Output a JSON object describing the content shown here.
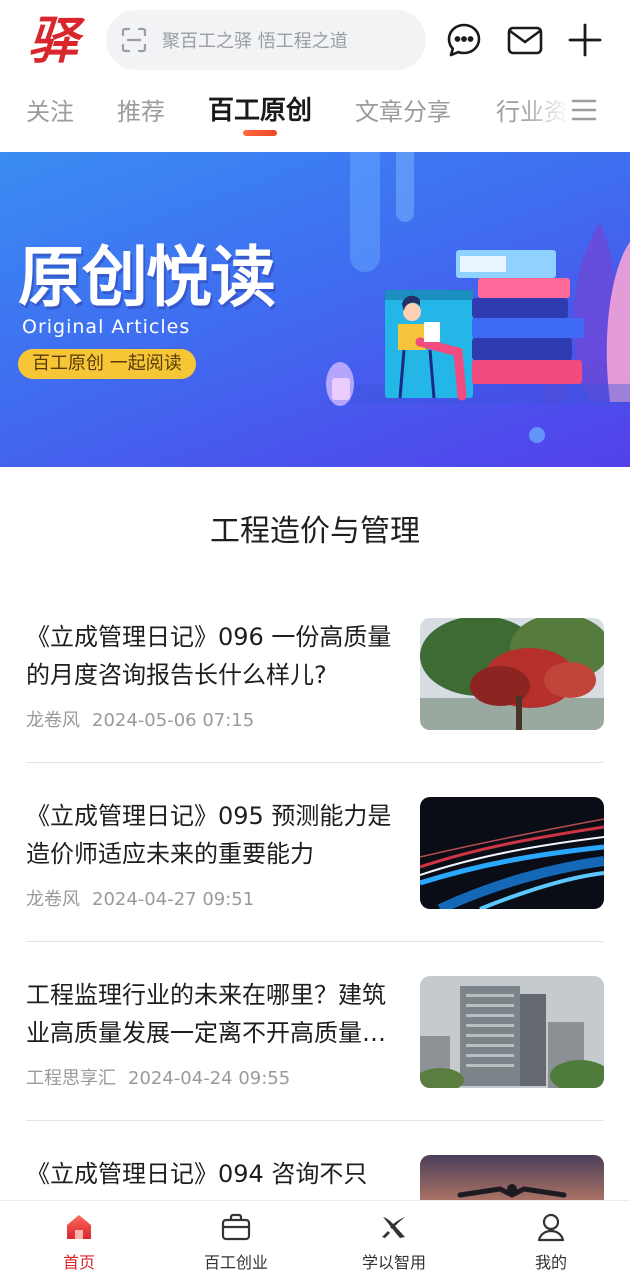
{
  "header": {
    "logo_text": "驿",
    "search_placeholder": "聚百工之驿 悟工程之道",
    "icons": [
      "logo-icon",
      "scan-icon",
      "chat-icon",
      "mail-icon",
      "plus-icon"
    ]
  },
  "tabs": [
    {
      "label": "关注",
      "active": false
    },
    {
      "label": "推荐",
      "active": false
    },
    {
      "label": "百工原创",
      "active": true
    },
    {
      "label": "文章分享",
      "active": false
    },
    {
      "label": "行业资",
      "active": false
    }
  ],
  "banner": {
    "title": "原创悦读",
    "subtitle": "Original Articles",
    "pill": "百工原创 一起阅读"
  },
  "section_title": "工程造价与管理",
  "articles": [
    {
      "title": "《立成管理日记》096 一份高质量的月度咨询报告长什么样儿?",
      "author": "龙卷风",
      "time": "2024-05-06 07:15",
      "thumb": "tree-photo"
    },
    {
      "title": "《立成管理日记》095 预测能力是造价师适应未来的重要能力",
      "author": "龙卷风",
      "time": "2024-04-27 09:51",
      "thumb": "light-trails-photo"
    },
    {
      "title": "工程监理行业的未来在哪里？建筑业高质量发展一定离不开高质量的监理",
      "author": "工程思享汇",
      "time": "2024-04-24 09:55",
      "thumb": "building-photo"
    },
    {
      "title": "《立成管理日记》094 咨询不只",
      "author": "",
      "time": "",
      "thumb": "sunset-photo"
    }
  ],
  "bottom_nav": [
    {
      "label": "首页",
      "icon": "home-icon",
      "active": true
    },
    {
      "label": "百工创业",
      "icon": "briefcase-icon",
      "active": false
    },
    {
      "label": "学以智用",
      "icon": "x-logo-icon",
      "active": false
    },
    {
      "label": "我的",
      "icon": "user-icon",
      "active": false
    }
  ],
  "colors": {
    "brand_red": "#d8262c",
    "tab_underline": "#f0462a",
    "banner_blue": "#3f6df0",
    "pill_yellow": "#f7c637"
  }
}
